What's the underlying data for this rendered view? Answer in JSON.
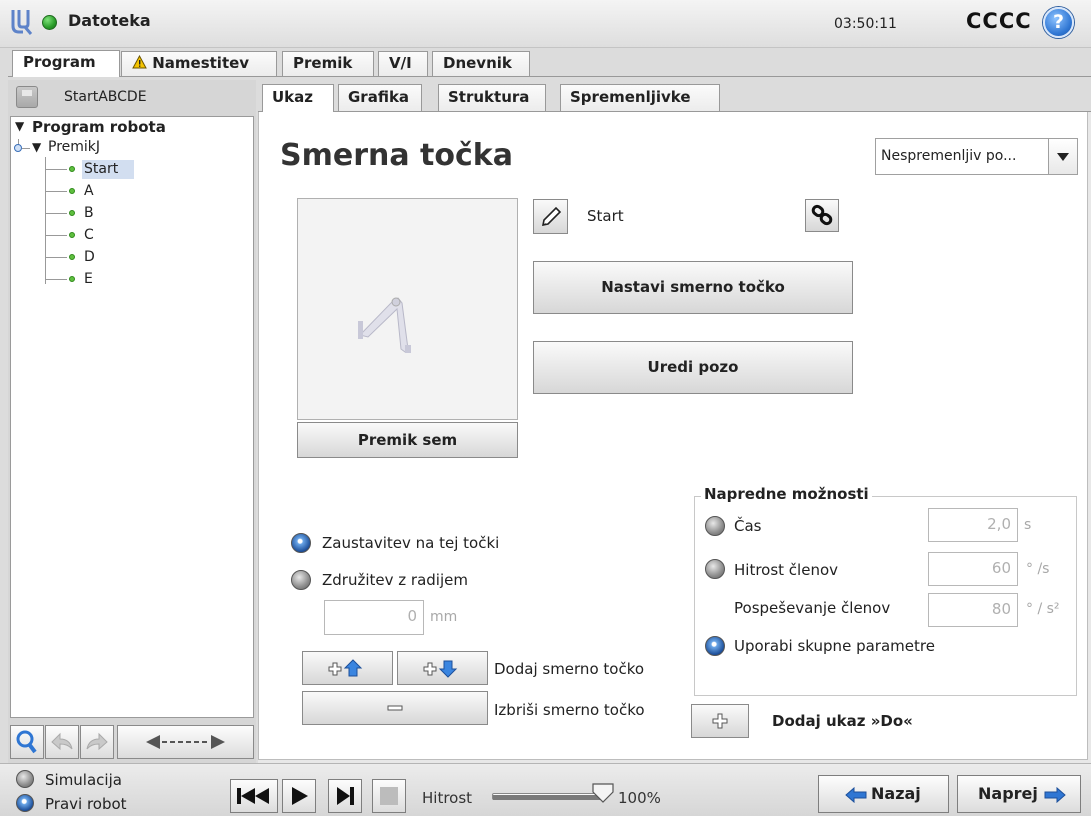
{
  "header": {
    "menu_title": "Datoteka",
    "clock": "03:50:11",
    "robot_name": "CCCC",
    "help_glyph": "?"
  },
  "main_tabs": [
    {
      "label": "Program",
      "active": true
    },
    {
      "label": "Namestitev",
      "warning": true
    },
    {
      "label": "Premik"
    },
    {
      "label": "V/I"
    },
    {
      "label": "Dnevnik"
    }
  ],
  "program": {
    "name": "StartABCDE",
    "tree": {
      "root": "Program robota",
      "move": "PremikJ",
      "items": [
        "Start",
        "A",
        "B",
        "C",
        "D",
        "E"
      ],
      "selected": "Start"
    }
  },
  "sub_tabs": [
    "Ukaz",
    "Grafika",
    "Struktura",
    "Spremenljivke"
  ],
  "waypoint": {
    "heading": "Smerna točka",
    "type_dropdown": "Nespremenljiv po...",
    "name": "Start",
    "move_here_label": "Premik sem",
    "set_waypoint_label": "Nastavi smerno točko",
    "edit_pose_label": "Uredi pozo",
    "stop_label": "Zaustavitev na tej točki",
    "blend_label": "Združitev z radijem",
    "blend_value": "0",
    "blend_unit": "mm",
    "stop_selected": true,
    "add_label": "Dodaj smerno točko",
    "delete_label": "Izbriši smerno točko"
  },
  "advanced": {
    "title": "Napredne možnosti",
    "time_label": "Čas",
    "time_value": "2,0",
    "time_unit": "s",
    "joint_speed_label": "Hitrost členov",
    "joint_speed_value": "60",
    "joint_speed_unit": "° /s",
    "joint_accel_label": "Pospeševanje členov",
    "joint_accel_value": "80",
    "joint_accel_unit": "° / s²",
    "shared_label": "Uporabi skupne parametre",
    "shared_selected": true
  },
  "until": {
    "label": "Dodaj ukaz »Do«"
  },
  "footer": {
    "simulation_label": "Simulacija",
    "real_robot_label": "Pravi robot",
    "real_robot_selected": true,
    "speed_label": "Hitrost",
    "speed_value": "100%",
    "speed_fraction": 1.0,
    "back_label": "Nazaj",
    "next_label": "Naprej"
  },
  "colors": {
    "accent_blue": "#2f76d3",
    "status_green": "#2a9d2a",
    "warning_yellow": "#f5c400"
  }
}
